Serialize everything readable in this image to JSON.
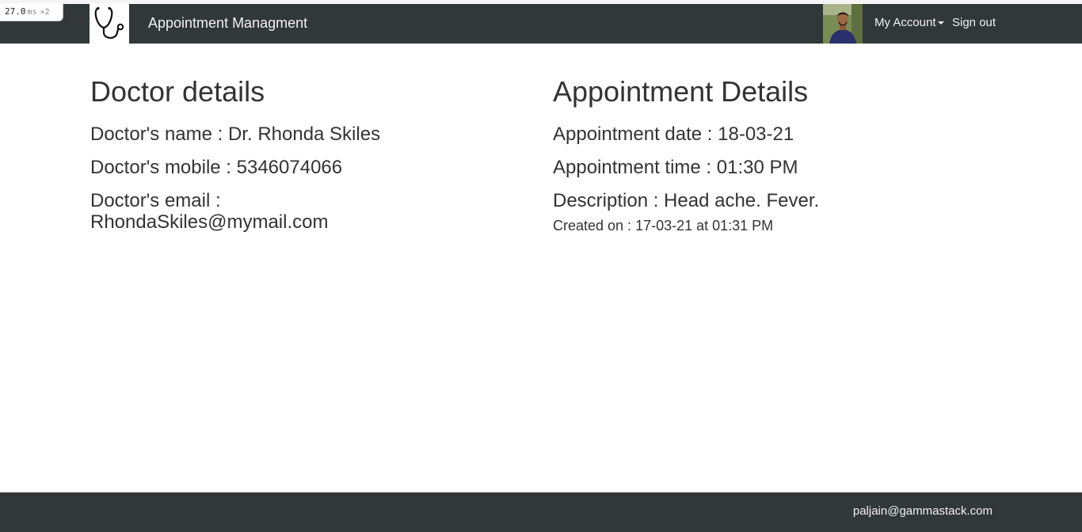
{
  "perf_overlay": {
    "time": "27.0",
    "unit": "ms",
    "multiplier": "×2"
  },
  "header": {
    "brand": "Appointment Managment",
    "logo_icon": "stethoscope-icon",
    "account_label": "My Account",
    "signout_label": "Sign out"
  },
  "doctor": {
    "heading": "Doctor details",
    "name_line": "Doctor's name : Dr. Rhonda Skiles",
    "mobile_line": "Doctor's mobile : 5346074066",
    "email_label": "Doctor's email :",
    "email_value": "RhondaSkiles@mymail.com"
  },
  "appointment": {
    "heading": "Appointment Details",
    "date_line": "Appointment date : 18-03-21",
    "time_line": "Appointment time : 01:30 PM",
    "description_line": "Description : Head ache. Fever.",
    "created_line": "Created on : 17-03-21 at 01:31 PM"
  },
  "footer": {
    "email": "paljain@gammastack.com"
  },
  "colors": {
    "navbar": "#323739",
    "text": "#333333",
    "nav_text": "#f2f2f2"
  }
}
